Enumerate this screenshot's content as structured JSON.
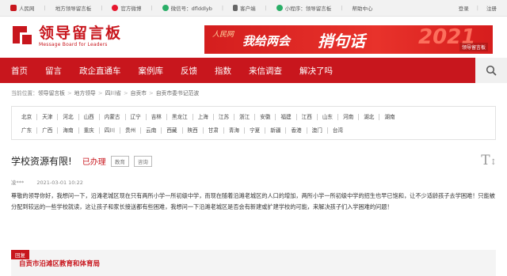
{
  "topbar": {
    "items": [
      {
        "label": "人民网",
        "icon": "people-daily-icon",
        "color": "#c8161d"
      },
      {
        "label": "地方领导留言板",
        "icon": "",
        "color": ""
      },
      {
        "label": "官方微博",
        "icon": "weibo-icon",
        "color": "#e6162d"
      },
      {
        "label": "微信号：dflddlyb",
        "icon": "wechat-icon",
        "color": "#2aae67"
      },
      {
        "label": "客户端",
        "icon": "mobile-app-icon",
        "color": "#555"
      },
      {
        "label": "小程序：领导留言板",
        "icon": "mini-program-icon",
        "color": "#2aae67"
      }
    ],
    "help": "帮助中心",
    "login": "登录",
    "register": "注册"
  },
  "logo": {
    "cn": "领导留言板",
    "en": "Message Board for Leaders"
  },
  "banner": {
    "source": "人民网",
    "text1": "我给两会",
    "text2": "捎句话",
    "year": "2021",
    "brand": "领导留言板"
  },
  "nav": {
    "items": [
      "首页",
      "留言",
      "政企直通车",
      "案例库",
      "反馈",
      "指数",
      "来信调查",
      "解决了吗"
    ]
  },
  "breadcrumb": {
    "label": "当前位置：",
    "items": [
      "领导留言板",
      "地方领导",
      "四川省",
      "自贡市",
      "自贡市委书记范波"
    ]
  },
  "provinces": [
    [
      "北京",
      "天津",
      "河北",
      "山西",
      "内蒙古",
      "辽宁",
      "吉林",
      "黑龙江",
      "上海",
      "江苏",
      "浙江",
      "安徽",
      "福建",
      "江西",
      "山东",
      "河南",
      "湖北",
      "湖南"
    ],
    [
      "广东",
      "广西",
      "海南",
      "重庆",
      "四川",
      "贵州",
      "云南",
      "西藏",
      "陕西",
      "甘肃",
      "青海",
      "宁夏",
      "新疆",
      "香港",
      "澳门",
      "台湾"
    ]
  ],
  "message": {
    "title": "学校资源有限!",
    "status": "已办理",
    "tags": [
      "教育",
      "咨询"
    ],
    "author": "凌***",
    "date": "2021-03-01 10:22",
    "body": "尊敬的领导你好，我想问一下，沿滩老城区现在只有两所小学一所初级中学，而现在随着沿滩老城区的人口的增加，两所小学一所初级中学的招生也早已饱和，让不少适龄孩子去学困难！只能被分配到较远的一些学校就读，这让孩子和家长接送都有些困难，我想问一下沿滩老城区是否会有新建或扩建学校的可能，来解决孩子们入学困难的问题！"
  },
  "reply": {
    "label": "回复",
    "org": "自贡市沿滩区教育和体育局"
  }
}
